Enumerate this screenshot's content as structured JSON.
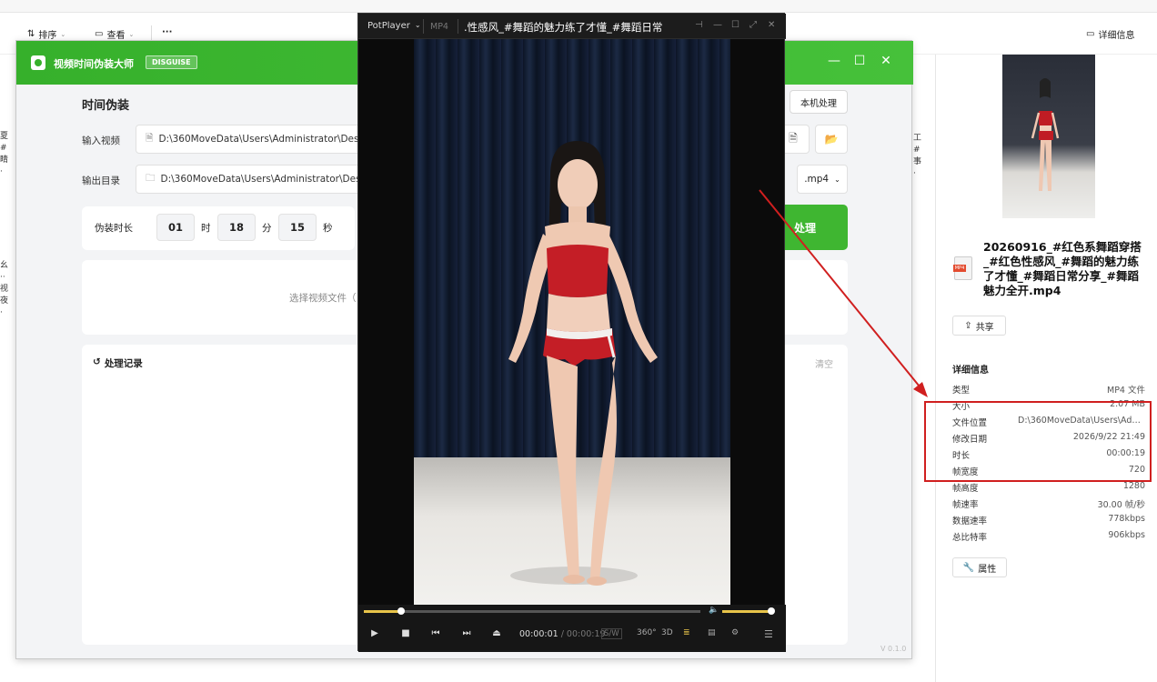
{
  "explorer": {
    "sort_label": "排序",
    "view_label": "查看",
    "more_label": "···",
    "details_label": "详细信息",
    "left_strip_top": "夏 # 睛 ·",
    "left_strip_mid": "幺 ·· 视 夜 ·",
    "right_strip": "工 # 事 ·"
  },
  "details": {
    "file_name": "20260916_#红色系舞蹈穿搭_#红色性感风_#舞蹈的魅力练了才懂_#舞蹈日常分享_#舞蹈魅力全开.mp4",
    "file_ext": "MP4",
    "share_label": "共享",
    "section_title": "详细信息",
    "rows": [
      {
        "label": "类型",
        "value": "MP4 文件"
      },
      {
        "label": "大小",
        "value": "2.07 MB"
      },
      {
        "label": "文件位置",
        "value": "D:\\360MoveData\\Users\\Admi..."
      },
      {
        "label": "修改日期",
        "value": "2026/9/22 21:49"
      },
      {
        "label": "时长",
        "value": "00:00:19"
      },
      {
        "label": "帧宽度",
        "value": "720"
      },
      {
        "label": "帧高度",
        "value": "1280"
      },
      {
        "label": "帧速率",
        "value": "30.00 帧/秒"
      },
      {
        "label": "数据速率",
        "value": "778kbps"
      },
      {
        "label": "总比特率",
        "value": "906kbps"
      }
    ],
    "properties_label": "属性"
  },
  "app": {
    "name": "视频时间伪装大师",
    "badge": "DISGUISE",
    "section_title": "时间伪装",
    "local_button": "本机处理",
    "input_label": "输入视频",
    "input_path": "D:\\360MoveData\\Users\\Administrator\\Desktop",
    "output_label": "输出目录",
    "output_path": "D:\\360MoveData\\Users\\Administrator\\Desktop",
    "extension": ".mp4",
    "duration_label": "伪装时长",
    "hours": "01",
    "hours_unit": "时",
    "minutes": "18",
    "minutes_unit": "分",
    "seconds": "15",
    "seconds_unit": "秒",
    "process_button": "处理",
    "drop_text": "选择视频文件（",
    "log_title": "处理记录",
    "clear_label": "清空",
    "version": "V 0.1.0"
  },
  "player": {
    "brand": "PotPlayer",
    "format": "MP4",
    "title": ".性感风_#舞蹈的魅力练了才懂_#舞蹈日常",
    "current_time": "00:00:01",
    "total_time": "/ 00:00:19",
    "sw_label": "S/W",
    "label_360": "360°",
    "label_3d": "3D",
    "progress_fraction": 0.11
  },
  "colors": {
    "app_green": "#3fb631",
    "highlight_red": "#d01f1f",
    "seek_yellow": "#e8c44a"
  }
}
